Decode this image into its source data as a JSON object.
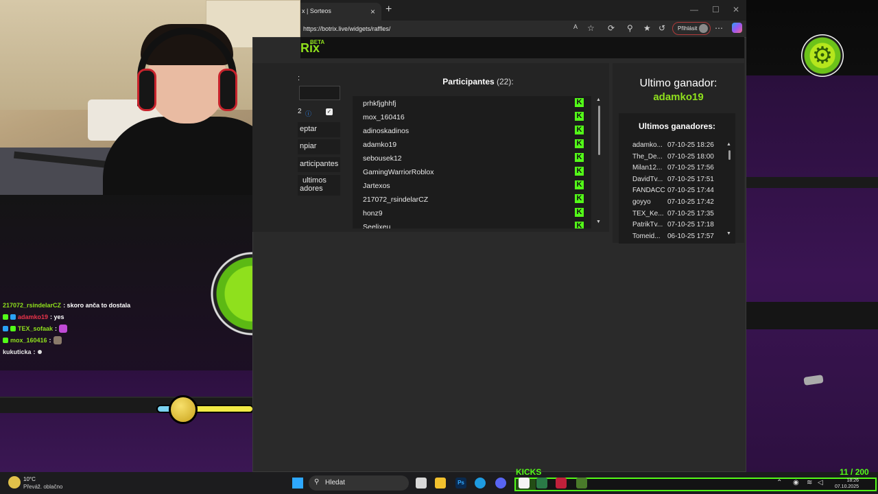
{
  "browser": {
    "tab_title": "x | Sorteos",
    "url": "https://botrix.live/widgets/raffles/",
    "sign_in_label": "Přihlásit",
    "window_controls": {
      "minimize": "—",
      "maximize": "☐",
      "close": "✕"
    },
    "new_tab": "+",
    "tab_close": "×"
  },
  "app": {
    "logo": "Rix",
    "beta": "BETA",
    "sidebar": {
      "field_label": ":",
      "option_text": "2",
      "accept_label": "eptar",
      "clear_label": "npiar",
      "participants_label": "articipantes",
      "last_winners_label_1": "ultimos",
      "last_winners_label_2": "adores"
    },
    "participants": {
      "title": "Participantes",
      "count": "(22):",
      "names": [
        "prhkfjghhfj",
        "mox_160416",
        "adinoskadinos",
        "adamko19",
        "sebousek12",
        "GamingWarriorRoblox",
        "Jartexos",
        "217072_rsindelarCZ",
        "honz9",
        "Seelixeu"
      ]
    },
    "last_winner": {
      "label": "Ultimo ganador:",
      "name": "adamko19"
    },
    "winners": {
      "title": "Ultimos ganadores:",
      "rows": [
        {
          "name": "adamko...",
          "date": "07-10-25 18:26"
        },
        {
          "name": "The_De...",
          "date": "07-10-25 18:00"
        },
        {
          "name": "Milan12...",
          "date": "07-10-25 17:56"
        },
        {
          "name": "DavidTv...",
          "date": "07-10-25 17:51"
        },
        {
          "name": "FANDACC",
          "date": "07-10-25 17:44"
        },
        {
          "name": "goyyo",
          "date": "07-10-25 17:42"
        },
        {
          "name": "TEX_Ke...",
          "date": "07-10-25 17:35"
        },
        {
          "name": "PatrikTv...",
          "date": "07-10-25 17:18"
        },
        {
          "name": "Tomeid...",
          "date": "06-10-25 17:57"
        }
      ]
    }
  },
  "chat": [
    {
      "user": "217072_rsindelarCZ",
      "user_color": "#8fe01d",
      "message": ": skoro anča to dostala"
    },
    {
      "user": "adamko19",
      "user_color": "#e8344a",
      "message": ": yes"
    },
    {
      "user": "TEX_sofaak",
      "user_color": "#8fe01d",
      "message": ":"
    },
    {
      "user": "mox_160416",
      "user_color": "#8fe01d",
      "message": ":"
    },
    {
      "user": "kukuticka",
      "user_color": "#e8e8e8",
      "message": ":"
    }
  ],
  "taskbar": {
    "weather_temp": "10°C",
    "weather_desc": "Převáž. oblačno",
    "search_label": "Hledat",
    "kicks_label": "KICKS",
    "kicks_count": "11 / 200",
    "kicks_progress": 0.055,
    "clock_time": "18:26",
    "clock_date": "07.10.2025"
  },
  "colors": {
    "accent": "#8fe01d",
    "kick_green": "#53fc18"
  }
}
